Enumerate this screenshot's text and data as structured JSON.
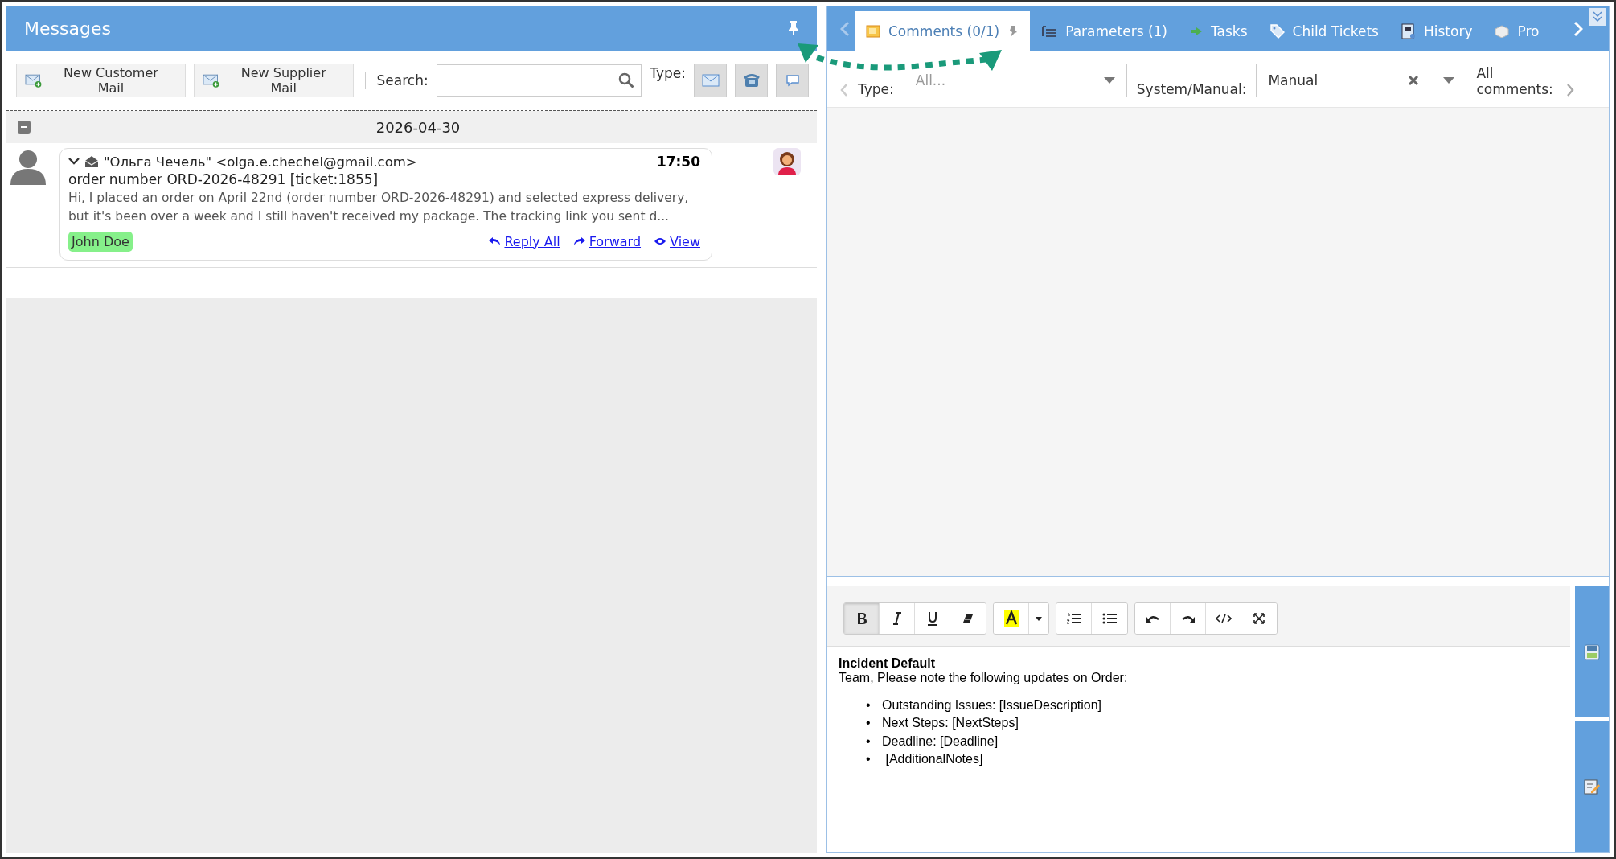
{
  "messages_panel": {
    "title": "Messages",
    "toolbar": {
      "buttons": [
        "New Customer Mail",
        "New Supplier Mail"
      ],
      "search_label": "Search:",
      "type_label": "Type:",
      "type_filters": [
        {
          "kind": "mail"
        },
        {
          "kind": "phone"
        },
        {
          "kind": "chat"
        }
      ]
    },
    "date_group": {
      "date": "2026-04-30",
      "expanded": true
    },
    "message": {
      "sender": "\"Ольга Чечель\" <olga.e.chechel@gmail.com>",
      "time": "17:50",
      "subject": "order number ORD-2026-48291 [ticket:1855]",
      "preview": "Hi, I placed an order on April 22nd (order number ORD-2026-48291) and selected express delivery, but it's been over a week and I still haven't received my package. The tracking link you sent d...",
      "assignee": "John Doe",
      "actions": [
        {
          "kind": "reply-all",
          "label": "Reply All"
        },
        {
          "kind": "forward",
          "label": "Forward"
        },
        {
          "kind": "view",
          "label": "View"
        }
      ]
    }
  },
  "tabs": [
    {
      "label": "Comments (0/1)",
      "kind": "comments",
      "selected": true
    },
    {
      "label": "Parameters (1)",
      "kind": "parameters",
      "selected": false
    },
    {
      "label": "Tasks",
      "kind": "tasks",
      "selected": false
    },
    {
      "label": "Child Tickets",
      "kind": "tags",
      "selected": false
    },
    {
      "label": "History",
      "kind": "history",
      "selected": false
    },
    {
      "label": "Pro",
      "kind": "box",
      "selected": false
    }
  ],
  "filters": {
    "type_label": "Type:",
    "type_placeholder": "All...",
    "system_label": "System/Manual:",
    "system_value": "Manual",
    "all_comments_label": "All comments:"
  },
  "editor": {
    "toolbar": [
      {
        "kind": "bold",
        "selected": true
      },
      {
        "kind": "italic",
        "selected": false
      },
      {
        "kind": "underline",
        "selected": false
      },
      {
        "kind": "eraser",
        "selected": false
      },
      {
        "kind": "sep"
      },
      {
        "kind": "highlight",
        "selected": false
      },
      {
        "kind": "dropdown",
        "selected": false
      },
      {
        "kind": "sep"
      },
      {
        "kind": "ol",
        "selected": false
      },
      {
        "kind": "ul",
        "selected": false
      },
      {
        "kind": "sep"
      },
      {
        "kind": "undo",
        "selected": false
      },
      {
        "kind": "redo",
        "selected": false
      },
      {
        "kind": "code",
        "selected": false
      },
      {
        "kind": "fullscreen",
        "selected": false
      }
    ],
    "heading": "Incident Default",
    "bullet_marker": "•",
    "intro": "Team, Please note the following updates on Order:",
    "bullets": [
      "Outstanding Issues: [IssueDescription]",
      "Next Steps: [NextSteps]",
      "Deadline: [Deadline]",
      " [AdditionalNotes]"
    ]
  }
}
